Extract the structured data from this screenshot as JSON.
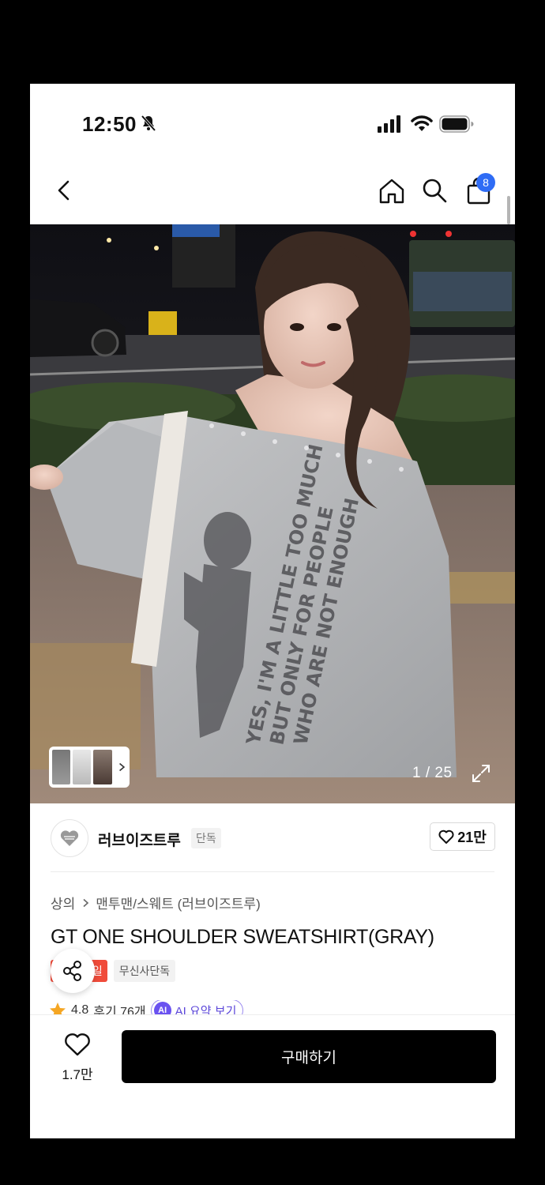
{
  "status_bar": {
    "time": "12:50"
  },
  "header": {
    "cart_count": "8"
  },
  "gallery": {
    "counter": "1 / 25"
  },
  "brand": {
    "name": "러브이즈트루",
    "tag": "단독",
    "likes": "21만"
  },
  "product": {
    "breadcrumb": [
      "상의",
      "맨투맨/스웨트 (러브이즈트루)"
    ],
    "title": "GT ONE SHOULDER SWEATSHIRT(GRAY)",
    "tags": [
      "세일",
      "무신사단독"
    ],
    "rating": "4.8",
    "reviews": "후기 76개",
    "ai_badge": "AI",
    "ai_label": "AI 요약 보기"
  },
  "bottom_bar": {
    "wish_count": "1.7만",
    "buy_label": "구매하기"
  },
  "colors": {
    "accent_blue": "#2f6cf5",
    "sale_red": "#f04b3a",
    "ai_purple": "#6a52f0",
    "star": "#f5a623"
  }
}
